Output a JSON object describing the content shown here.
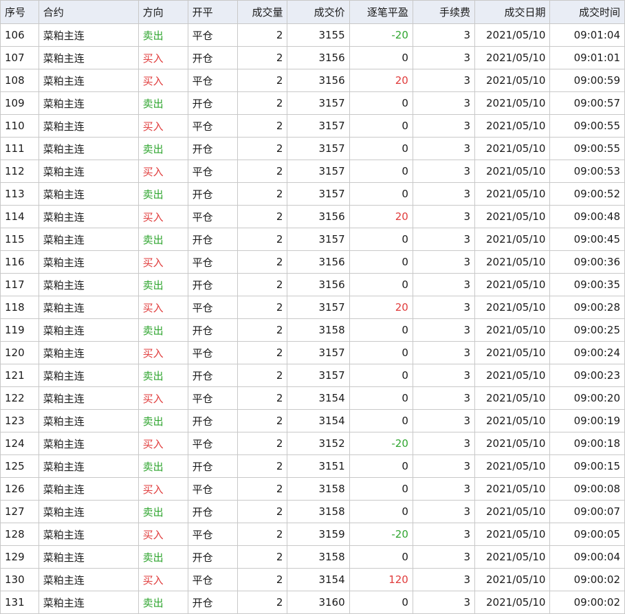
{
  "columns": [
    "序号",
    "合约",
    "方向",
    "开平",
    "成交量",
    "成交价",
    "逐笔平盈",
    "手续费",
    "成交日期",
    "成交时间"
  ],
  "colors": {
    "buy": "#e03b3b",
    "sell": "#2fa52f",
    "header_bg": "#e9edf5",
    "grid_line": "#c8c8c8"
  },
  "rows": [
    {
      "seq": "106",
      "contract": "菜粕主连",
      "direction": "卖出",
      "offset": "平仓",
      "volume": "2",
      "price": "3155",
      "pnl": "-20",
      "fee": "3",
      "date": "2021/05/10",
      "time": "09:01:04"
    },
    {
      "seq": "107",
      "contract": "菜粕主连",
      "direction": "买入",
      "offset": "开仓",
      "volume": "2",
      "price": "3156",
      "pnl": "0",
      "fee": "3",
      "date": "2021/05/10",
      "time": "09:01:01"
    },
    {
      "seq": "108",
      "contract": "菜粕主连",
      "direction": "买入",
      "offset": "平仓",
      "volume": "2",
      "price": "3156",
      "pnl": "20",
      "fee": "3",
      "date": "2021/05/10",
      "time": "09:00:59"
    },
    {
      "seq": "109",
      "contract": "菜粕主连",
      "direction": "卖出",
      "offset": "开仓",
      "volume": "2",
      "price": "3157",
      "pnl": "0",
      "fee": "3",
      "date": "2021/05/10",
      "time": "09:00:57"
    },
    {
      "seq": "110",
      "contract": "菜粕主连",
      "direction": "买入",
      "offset": "平仓",
      "volume": "2",
      "price": "3157",
      "pnl": "0",
      "fee": "3",
      "date": "2021/05/10",
      "time": "09:00:55"
    },
    {
      "seq": "111",
      "contract": "菜粕主连",
      "direction": "卖出",
      "offset": "开仓",
      "volume": "2",
      "price": "3157",
      "pnl": "0",
      "fee": "3",
      "date": "2021/05/10",
      "time": "09:00:55"
    },
    {
      "seq": "112",
      "contract": "菜粕主连",
      "direction": "买入",
      "offset": "平仓",
      "volume": "2",
      "price": "3157",
      "pnl": "0",
      "fee": "3",
      "date": "2021/05/10",
      "time": "09:00:53"
    },
    {
      "seq": "113",
      "contract": "菜粕主连",
      "direction": "卖出",
      "offset": "开仓",
      "volume": "2",
      "price": "3157",
      "pnl": "0",
      "fee": "3",
      "date": "2021/05/10",
      "time": "09:00:52"
    },
    {
      "seq": "114",
      "contract": "菜粕主连",
      "direction": "买入",
      "offset": "平仓",
      "volume": "2",
      "price": "3156",
      "pnl": "20",
      "fee": "3",
      "date": "2021/05/10",
      "time": "09:00:48"
    },
    {
      "seq": "115",
      "contract": "菜粕主连",
      "direction": "卖出",
      "offset": "开仓",
      "volume": "2",
      "price": "3157",
      "pnl": "0",
      "fee": "3",
      "date": "2021/05/10",
      "time": "09:00:45"
    },
    {
      "seq": "116",
      "contract": "菜粕主连",
      "direction": "买入",
      "offset": "平仓",
      "volume": "2",
      "price": "3156",
      "pnl": "0",
      "fee": "3",
      "date": "2021/05/10",
      "time": "09:00:36"
    },
    {
      "seq": "117",
      "contract": "菜粕主连",
      "direction": "卖出",
      "offset": "开仓",
      "volume": "2",
      "price": "3156",
      "pnl": "0",
      "fee": "3",
      "date": "2021/05/10",
      "time": "09:00:35"
    },
    {
      "seq": "118",
      "contract": "菜粕主连",
      "direction": "买入",
      "offset": "平仓",
      "volume": "2",
      "price": "3157",
      "pnl": "20",
      "fee": "3",
      "date": "2021/05/10",
      "time": "09:00:28"
    },
    {
      "seq": "119",
      "contract": "菜粕主连",
      "direction": "卖出",
      "offset": "开仓",
      "volume": "2",
      "price": "3158",
      "pnl": "0",
      "fee": "3",
      "date": "2021/05/10",
      "time": "09:00:25"
    },
    {
      "seq": "120",
      "contract": "菜粕主连",
      "direction": "买入",
      "offset": "平仓",
      "volume": "2",
      "price": "3157",
      "pnl": "0",
      "fee": "3",
      "date": "2021/05/10",
      "time": "09:00:24"
    },
    {
      "seq": "121",
      "contract": "菜粕主连",
      "direction": "卖出",
      "offset": "开仓",
      "volume": "2",
      "price": "3157",
      "pnl": "0",
      "fee": "3",
      "date": "2021/05/10",
      "time": "09:00:23"
    },
    {
      "seq": "122",
      "contract": "菜粕主连",
      "direction": "买入",
      "offset": "平仓",
      "volume": "2",
      "price": "3154",
      "pnl": "0",
      "fee": "3",
      "date": "2021/05/10",
      "time": "09:00:20"
    },
    {
      "seq": "123",
      "contract": "菜粕主连",
      "direction": "卖出",
      "offset": "开仓",
      "volume": "2",
      "price": "3154",
      "pnl": "0",
      "fee": "3",
      "date": "2021/05/10",
      "time": "09:00:19"
    },
    {
      "seq": "124",
      "contract": "菜粕主连",
      "direction": "买入",
      "offset": "平仓",
      "volume": "2",
      "price": "3152",
      "pnl": "-20",
      "fee": "3",
      "date": "2021/05/10",
      "time": "09:00:18"
    },
    {
      "seq": "125",
      "contract": "菜粕主连",
      "direction": "卖出",
      "offset": "开仓",
      "volume": "2",
      "price": "3151",
      "pnl": "0",
      "fee": "3",
      "date": "2021/05/10",
      "time": "09:00:15"
    },
    {
      "seq": "126",
      "contract": "菜粕主连",
      "direction": "买入",
      "offset": "平仓",
      "volume": "2",
      "price": "3158",
      "pnl": "0",
      "fee": "3",
      "date": "2021/05/10",
      "time": "09:00:08"
    },
    {
      "seq": "127",
      "contract": "菜粕主连",
      "direction": "卖出",
      "offset": "开仓",
      "volume": "2",
      "price": "3158",
      "pnl": "0",
      "fee": "3",
      "date": "2021/05/10",
      "time": "09:00:07"
    },
    {
      "seq": "128",
      "contract": "菜粕主连",
      "direction": "买入",
      "offset": "平仓",
      "volume": "2",
      "price": "3159",
      "pnl": "-20",
      "fee": "3",
      "date": "2021/05/10",
      "time": "09:00:05"
    },
    {
      "seq": "129",
      "contract": "菜粕主连",
      "direction": "卖出",
      "offset": "开仓",
      "volume": "2",
      "price": "3158",
      "pnl": "0",
      "fee": "3",
      "date": "2021/05/10",
      "time": "09:00:04"
    },
    {
      "seq": "130",
      "contract": "菜粕主连",
      "direction": "买入",
      "offset": "平仓",
      "volume": "2",
      "price": "3154",
      "pnl": "120",
      "fee": "3",
      "date": "2021/05/10",
      "time": "09:00:02"
    },
    {
      "seq": "131",
      "contract": "菜粕主连",
      "direction": "卖出",
      "offset": "开仓",
      "volume": "2",
      "price": "3160",
      "pnl": "0",
      "fee": "3",
      "date": "2021/05/10",
      "time": "09:00:02"
    }
  ]
}
